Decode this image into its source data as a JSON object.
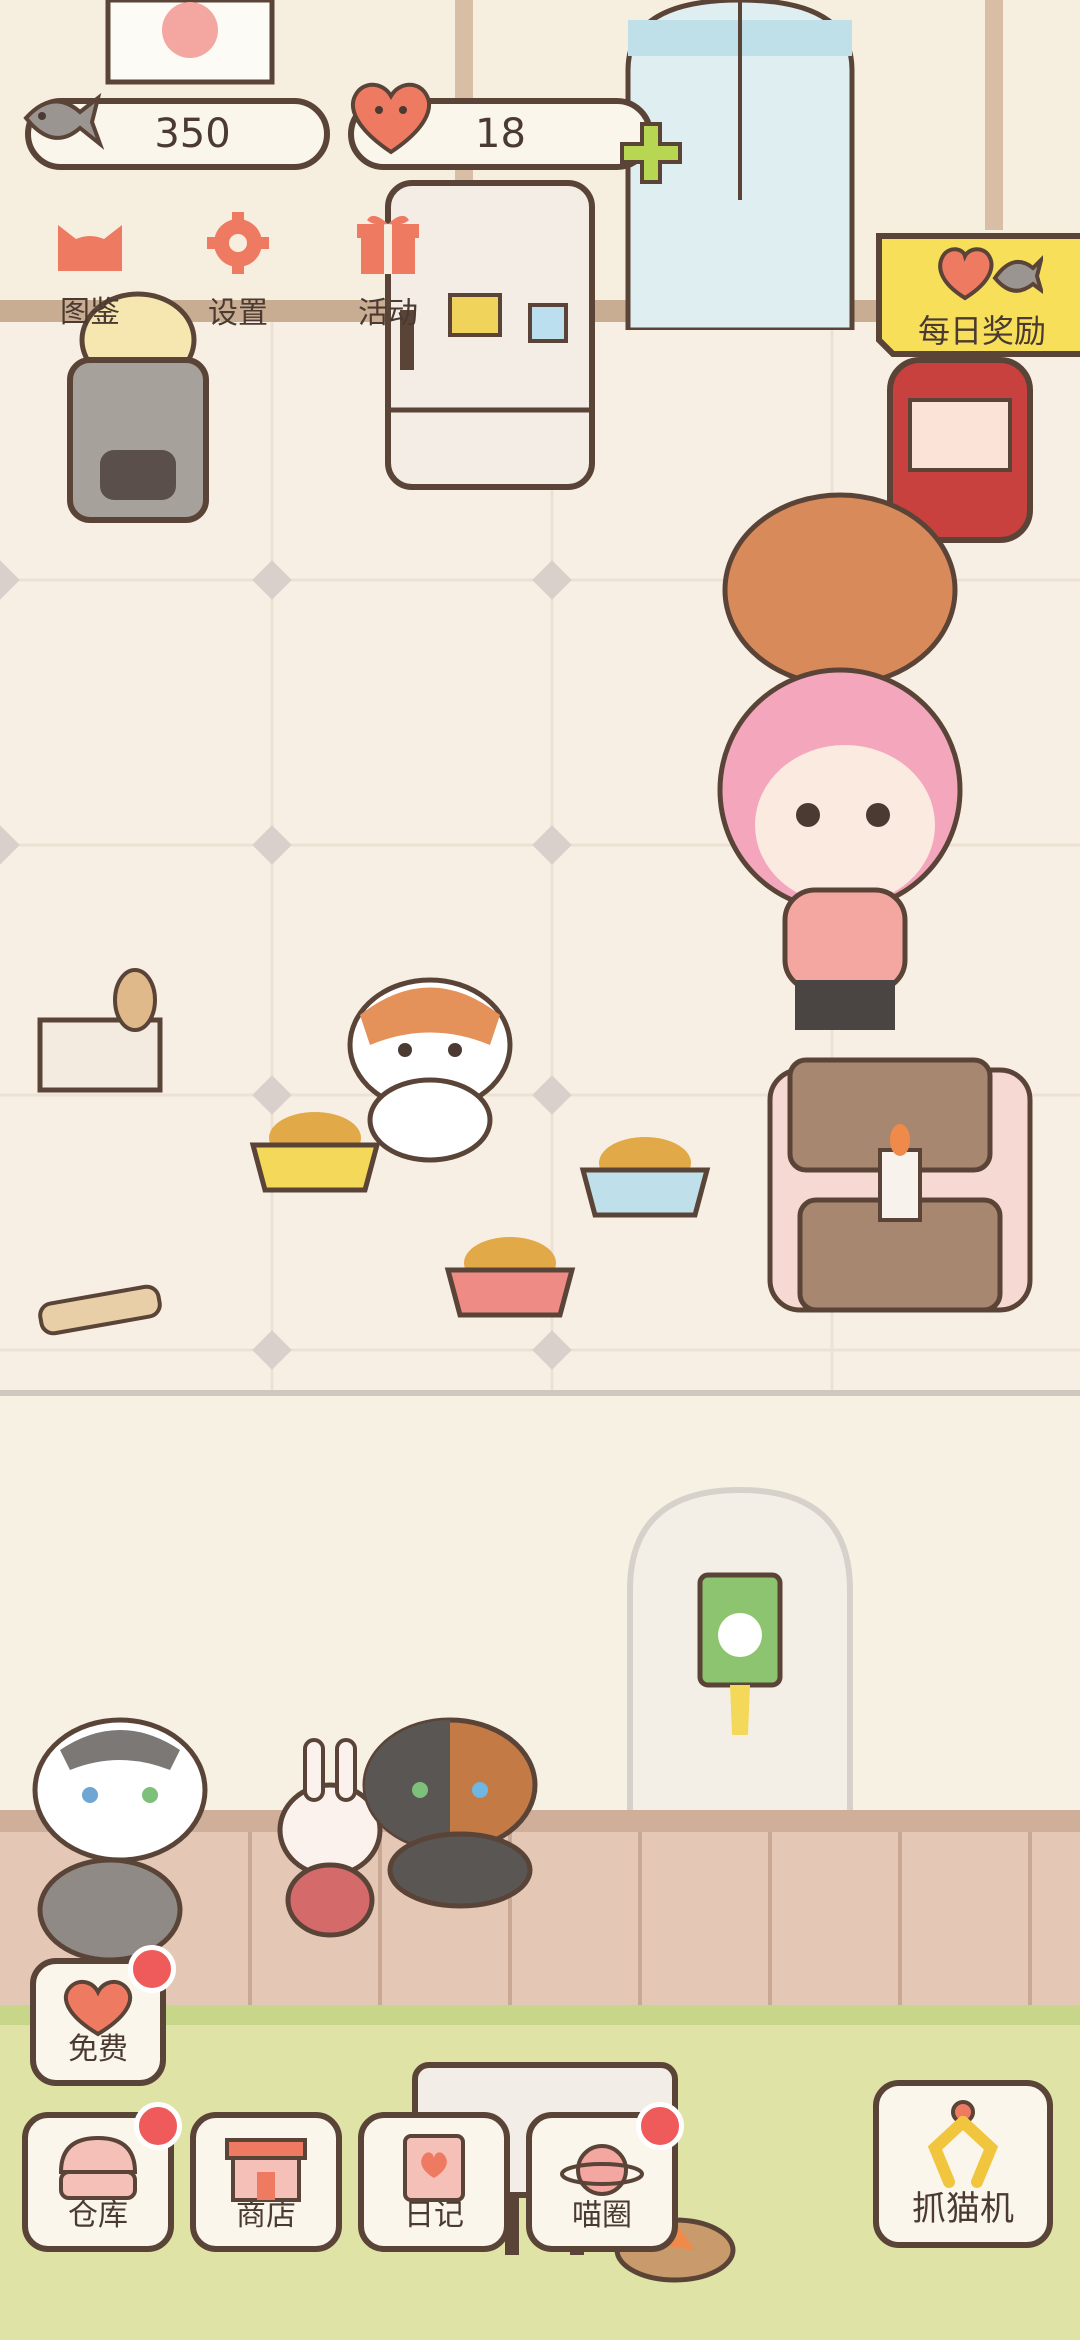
{
  "hud": {
    "fish_count": "350",
    "heart_count": "18"
  },
  "top_menu": [
    {
      "label": "图鉴",
      "icon": "cat-head-icon"
    },
    {
      "label": "设置",
      "icon": "gear-icon"
    },
    {
      "label": "活动",
      "icon": "gift-icon"
    }
  ],
  "daily_reward": {
    "label": "每日奖励"
  },
  "free_button": {
    "label": "免费"
  },
  "bottom_nav": [
    {
      "label": "仓库",
      "icon": "storage-icon",
      "badge": true
    },
    {
      "label": "商店",
      "icon": "shop-icon",
      "badge": false
    },
    {
      "label": "日记",
      "icon": "diary-icon",
      "badge": false
    },
    {
      "label": "喵圈",
      "icon": "planet-cat-icon",
      "badge": true
    }
  ],
  "claw_machine": {
    "label": "抓猫机",
    "icon": "claw-icon"
  },
  "colors": {
    "accent_coral": "#ef7a62",
    "badge_red": "#ef5a5a",
    "banner_yellow": "#f7df5a",
    "outline_brown": "#5a4437"
  }
}
